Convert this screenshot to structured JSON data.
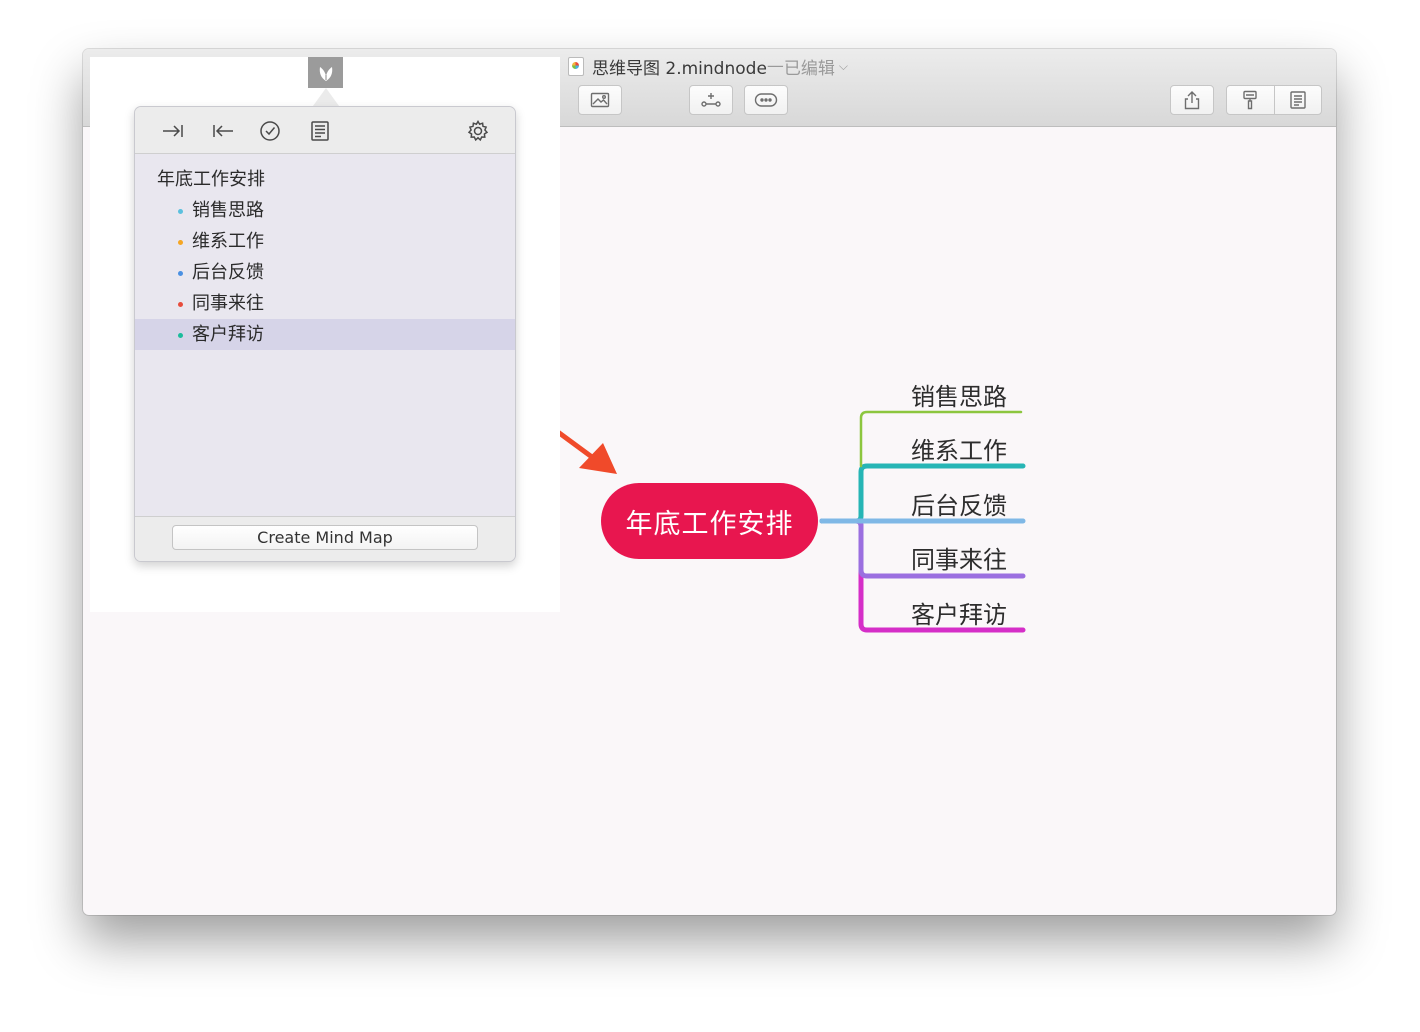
{
  "window": {
    "file_name": "思维导图 2.mindnode",
    "separator": " — ",
    "status": "已编辑",
    "status_chevron": "⌵"
  },
  "toolbar_icons": [
    "image-icon",
    "add-node-icon",
    "more-icon",
    "share-icon",
    "theme-brush-icon",
    "notes-icon"
  ],
  "outline_panel": {
    "toolbar_icons": [
      "indent-icon",
      "outdent-icon",
      "check-task-icon",
      "note-icon",
      "settings-gear-icon"
    ],
    "root": "年底工作安排",
    "items": [
      {
        "label": "销售思路",
        "color": "#5bc0de"
      },
      {
        "label": "维系工作",
        "color": "#f5a623"
      },
      {
        "label": "后台反馈",
        "color": "#4a90e2"
      },
      {
        "label": "同事来往",
        "color": "#e74c3c"
      },
      {
        "label": "客户拜访",
        "color": "#1abc9c",
        "selected": true
      }
    ],
    "create_button": "Create Mind Map"
  },
  "mind_map": {
    "central": {
      "label": "年底工作安排",
      "color": "#e8164f"
    },
    "branches": [
      {
        "label": "销售思路",
        "color": "#8cc63f"
      },
      {
        "label": "维系工作",
        "color": "#26b5b5"
      },
      {
        "label": "后台反馈",
        "color": "#7fb8e6"
      },
      {
        "label": "同事来往",
        "color": "#9b6fe0"
      },
      {
        "label": "客户拜访",
        "color": "#d52ec8"
      }
    ]
  },
  "annotation": {
    "arrow_color": "#f04a2a"
  }
}
